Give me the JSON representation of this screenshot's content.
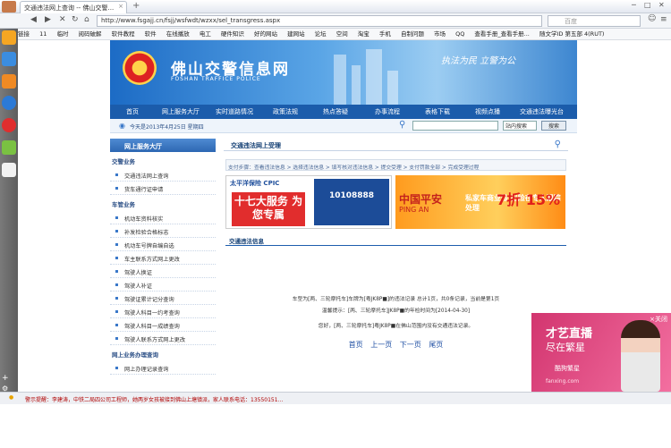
{
  "browser": {
    "tab_title": "交通违法网上查询 -- 佛山交警...",
    "tab_close": "×",
    "new_tab": "+",
    "url": "http://www.fsgajj.cn/fsjj/wsfwdt/wzxx/sel_transgress.aspx",
    "search_placeholder": "百度",
    "bookmarks": [
      "链接",
      "11",
      "临时",
      "阅码破解",
      "软件教程",
      "软件",
      "在线播放",
      "电工",
      "硬件知识",
      "好的网站",
      "建网站",
      "论坛",
      "空间",
      "淘宝",
      "手机",
      "自制问题",
      "市场",
      "QQ",
      "查看手册_查看手册...",
      "随文学ID 第五部 4(RUT)"
    ]
  },
  "site": {
    "title": "佛山交警信息网",
    "subtitle": "FOSHAN TRAFFICE POLICE",
    "slogan": "执法为民 立警为公",
    "nav": [
      "首页",
      "网上服务大厅",
      "实时道路情况",
      "政策法规",
      "热点答疑",
      "办事流程",
      "表格下载",
      "视频点播",
      "交通违法曝光台"
    ],
    "date": "今天是2013年4月25日 星期四",
    "search_select": "站内搜索",
    "search_button": "搜索"
  },
  "left": {
    "header": "网上服务大厅",
    "sections": [
      {
        "title": "交警业务",
        "items": [
          "交通违法网上查询",
          "货车通行证申请"
        ]
      },
      {
        "title": "车管业务",
        "items": [
          "机动车资料核实",
          "补发检验合格标志",
          "机动车号牌自编自选",
          "车主联系方式网上更改",
          "驾驶人换证",
          "驾驶人补证",
          "驾驶证累计记分查询",
          "驾驶人科目一约考查询",
          "驾驶人科目一成绩查询",
          "驾驶人联系方式网上更改"
        ]
      },
      {
        "title": "网上业务办理查询",
        "items": [
          "网上办理记录查询"
        ]
      }
    ]
  },
  "content": {
    "header": "交通违法网上受理",
    "steps": "支付步骤：查看违法信息 > 选择违法信息 > 填写核对违法信息 > 提交受理 > 支付罚款全部 > 完成受理过程",
    "ad1": {
      "logo": "太平洋保险 CPIC",
      "main": "十七大服务 为您专属",
      "phone": "10108888"
    },
    "ad2": {
      "name": "中国平安",
      "en": "PING AN",
      "text": "私家车商业险 出险在专人跟踪处理",
      "pct": "7折 15%"
    },
    "section": "交通违法信息",
    "msg1": "车型为[两、三轮摩托车]车牌为[粤JK8P■]的违法记录 总计1页，共0条记录，当前是第1页",
    "msg2": "温馨提示：[两、三轮摩托车]JK8P■的年检时间为[2014-04-30]",
    "msg3": "您好，[两、三轮摩托车]粤JK8P■在佛山范围内没有交通违法记录。",
    "pager": [
      "首页",
      "上一页",
      "下一页",
      "尾页"
    ]
  },
  "popup": {
    "title": "才艺直播",
    "sub": "尽在繁星",
    "brand": "酷狗繁星",
    "url": "fanxing.com",
    "close": "×关闭"
  },
  "status": "警示提醒：李建涛，中铁二局四公司工程师，她两岁女孩被接到佛山上塘镇派，家人联系电话：13550151..."
}
